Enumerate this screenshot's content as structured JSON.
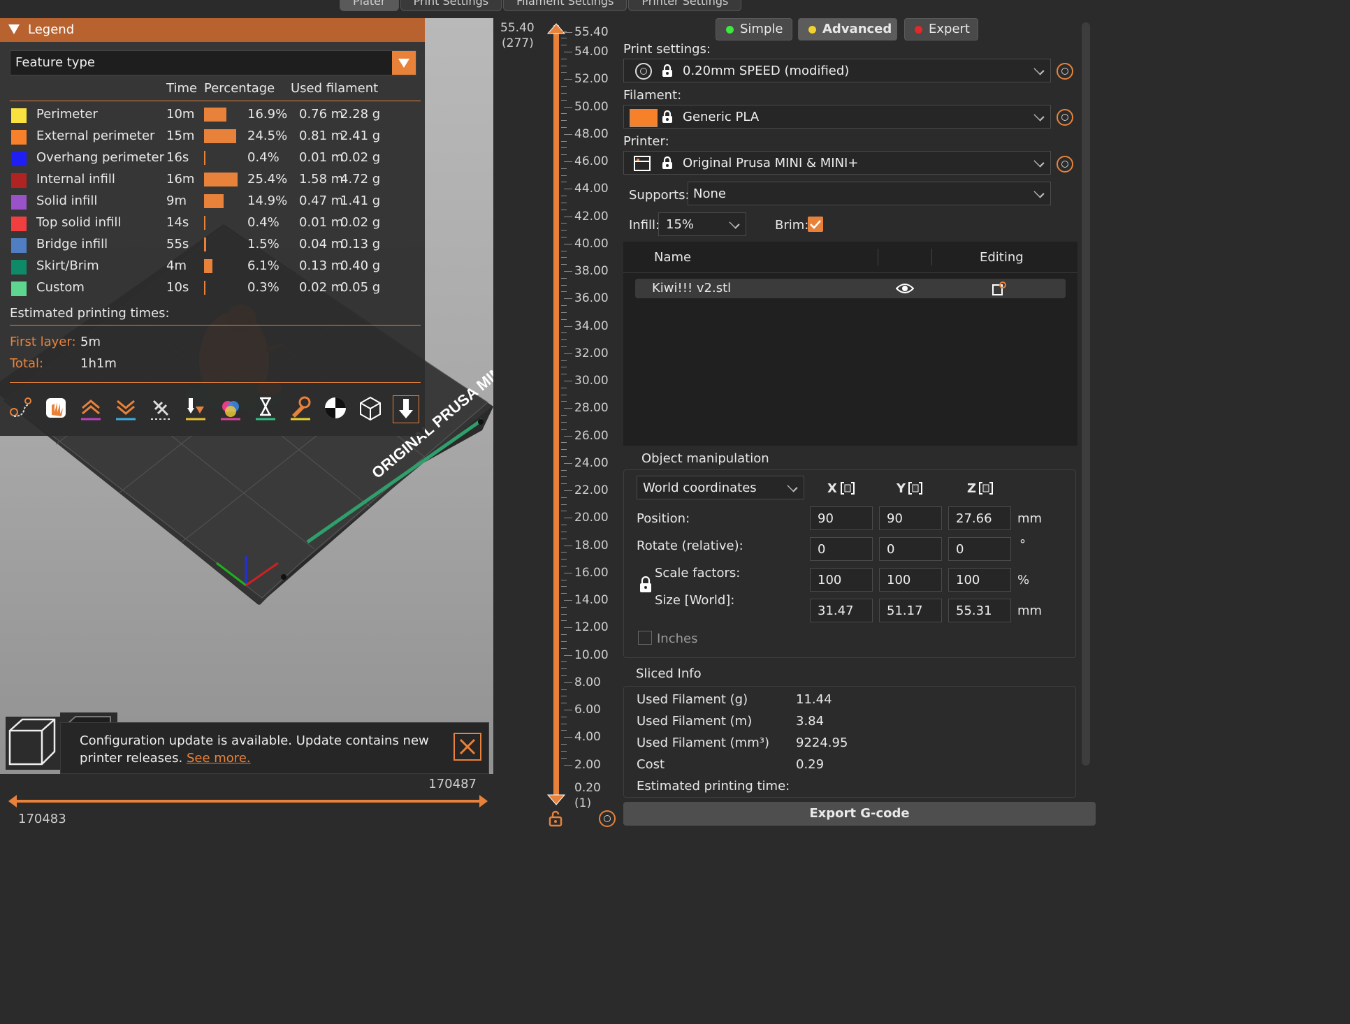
{
  "top_tabs": [
    "Plater",
    "Print Settings",
    "Filament Settings",
    "Printer Settings"
  ],
  "legend": {
    "title": "Legend",
    "view_type": "Feature type",
    "headers": {
      "time": "Time",
      "percentage": "Percentage",
      "used_filament": "Used filament"
    },
    "rows": [
      {
        "name": "Perimeter",
        "color": "#f9e140",
        "time": "10m",
        "pct": "16.9%",
        "pct_value": 16.9,
        "length": "0.76 m",
        "weight": "2.28 g"
      },
      {
        "name": "External perimeter",
        "color": "#f7812b",
        "time": "15m",
        "pct": "24.5%",
        "pct_value": 24.5,
        "length": "0.81 m",
        "weight": "2.41 g"
      },
      {
        "name": "Overhang perimeter",
        "color": "#1f1ff5",
        "time": "16s",
        "pct": "0.4%",
        "pct_value": 0.4,
        "length": "0.01 m",
        "weight": "0.02 g"
      },
      {
        "name": "Internal infill",
        "color": "#b02323",
        "time": "16m",
        "pct": "25.4%",
        "pct_value": 25.4,
        "length": "1.58 m",
        "weight": "4.72 g"
      },
      {
        "name": "Solid infill",
        "color": "#9a52c8",
        "time": "9m",
        "pct": "14.9%",
        "pct_value": 14.9,
        "length": "0.47 m",
        "weight": "1.41 g"
      },
      {
        "name": "Top solid infill",
        "color": "#f13f3f",
        "time": "14s",
        "pct": "0.4%",
        "pct_value": 0.4,
        "length": "0.01 m",
        "weight": "0.02 g"
      },
      {
        "name": "Bridge infill",
        "color": "#4f7fc2",
        "time": "55s",
        "pct": "1.5%",
        "pct_value": 1.5,
        "length": "0.04 m",
        "weight": "0.13 g"
      },
      {
        "name": "Skirt/Brim",
        "color": "#0f8a69",
        "time": "4m",
        "pct": "6.1%",
        "pct_value": 6.1,
        "length": "0.13 m",
        "weight": "0.40 g"
      },
      {
        "name": "Custom",
        "color": "#5ed68f",
        "time": "10s",
        "pct": "0.3%",
        "pct_value": 0.3,
        "length": "0.02 m",
        "weight": "0.05 g"
      }
    ],
    "estimated_title": "Estimated printing times:",
    "first_layer_label": "First layer:",
    "first_layer_value": "5m",
    "total_label": "Total:",
    "total_value": "1h1m",
    "tools": [
      "travel-icon",
      "retractions-icon",
      "deretractions-icon",
      "seams-icon",
      "wipes-icon",
      "tool-changes-icon",
      "color-changes-icon",
      "pause-icon",
      "custom-gcode-icon",
      "center-of-gravity-icon",
      "shells-icon",
      "tool-marker-icon"
    ]
  },
  "bed_label": "ORIGINAL PRUSA MINI",
  "notification": {
    "text": "Configuration update is available. Update contains new printer releases.",
    "link": "See more."
  },
  "hslider": {
    "top_value": "170487",
    "bottom_value": "170483"
  },
  "vslider": {
    "top_value": "55.40",
    "top_layer": "(277)",
    "bottom_value": "0.20",
    "bottom_layer": "(1)",
    "labels": [
      "55.40",
      "54.00",
      "52.00",
      "50.00",
      "48.00",
      "46.00",
      "44.00",
      "42.00",
      "40.00",
      "38.00",
      "36.00",
      "34.00",
      "32.00",
      "30.00",
      "28.00",
      "26.00",
      "24.00",
      "22.00",
      "20.00",
      "18.00",
      "16.00",
      "14.00",
      "12.00",
      "10.00",
      "8.00",
      "6.00",
      "4.00",
      "2.00"
    ]
  },
  "modes": {
    "simple": "Simple",
    "advanced": "Advanced",
    "expert": "Expert"
  },
  "mode_colors": {
    "simple": "#3ee83e",
    "advanced": "#f2d230",
    "expert": "#e02a2a"
  },
  "print_settings": {
    "label": "Print settings:",
    "value": "0.20mm SPEED (modified)"
  },
  "filament": {
    "label": "Filament:",
    "value": "Generic PLA",
    "color": "#f7812b"
  },
  "printer": {
    "label": "Printer:",
    "value": "Original Prusa MINI & MINI+"
  },
  "supports": {
    "label": "Supports:",
    "value": "None"
  },
  "infill": {
    "label": "Infill:",
    "value": "15%"
  },
  "brim": {
    "label": "Brim:",
    "checked": true
  },
  "object_list": {
    "col_name": "Name",
    "col_editing": "Editing",
    "items": [
      {
        "name": "Kiwi!!! v2.stl"
      }
    ]
  },
  "object_manipulation": {
    "title": "Object manipulation",
    "coord_system": "World coordinates",
    "axes": [
      "X",
      "Y",
      "Z"
    ],
    "position": {
      "label": "Position:",
      "x": "90",
      "y": "90",
      "z": "27.66",
      "unit": "mm"
    },
    "rotate": {
      "label": "Rotate (relative):",
      "x": "0",
      "y": "0",
      "z": "0",
      "unit": "°"
    },
    "scale": {
      "label": "Scale factors:",
      "x": "100",
      "y": "100",
      "z": "100",
      "unit": "%"
    },
    "size": {
      "label": "Size [World]:",
      "x": "31.47",
      "y": "51.17",
      "z": "55.31",
      "unit": "mm"
    },
    "inches_label": "Inches"
  },
  "sliced_info": {
    "title": "Sliced Info",
    "rows": [
      {
        "label": "Used Filament (g)",
        "value": "11.44"
      },
      {
        "label": "Used Filament (m)",
        "value": "3.84"
      },
      {
        "label": "Used Filament (mm³)",
        "value": "9224.95"
      },
      {
        "label": "Cost",
        "value": "0.29"
      },
      {
        "label": "Estimated printing time:",
        "value": ""
      }
    ]
  },
  "export_label": "Export G-code"
}
